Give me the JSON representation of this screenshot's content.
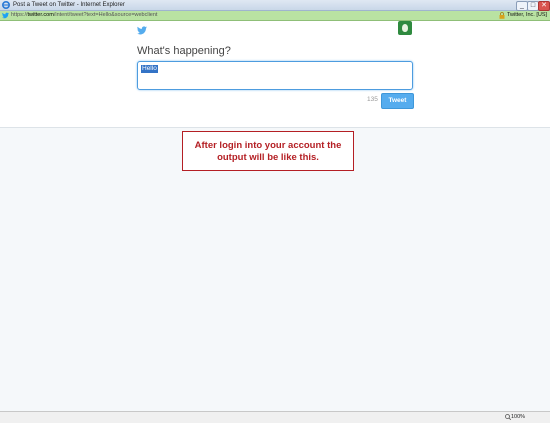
{
  "window": {
    "title": "Post a Tweet on Twitter - Internet Explorer",
    "minimize": "_",
    "maximize": "□",
    "close": "✕"
  },
  "address_bar": {
    "url_scheme": "https://",
    "url_host": "twitter.com",
    "url_path": "/intent/tweet?text=Hello&source=webclient",
    "certificate": "Twitter, Inc. [US]",
    "lock_icon": "lock-icon"
  },
  "compose": {
    "prompt": "What's happening?",
    "text": "Hello",
    "char_count": "135",
    "tweet_button": "Tweet"
  },
  "annotation": {
    "line1": "After login into your account the",
    "line2": "output will be like this."
  },
  "status_bar": {
    "zoom": "100%"
  },
  "colors": {
    "accent": "#55acee",
    "annotation": "#b41f24",
    "address_bar": "#b9e2a2"
  }
}
